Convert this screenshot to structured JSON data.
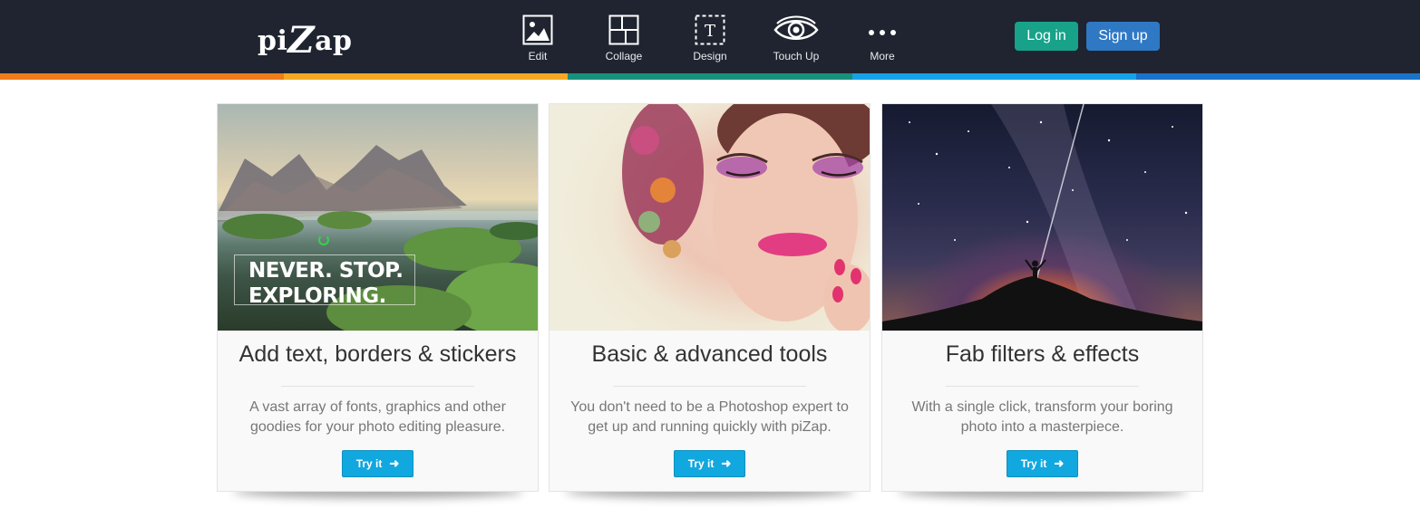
{
  "brand": {
    "logo_text_1": "pi",
    "logo_text_2": "Z",
    "logo_text_3": "ap"
  },
  "nav": [
    {
      "label": "Edit",
      "icon": "image-icon"
    },
    {
      "label": "Collage",
      "icon": "collage-grid-icon"
    },
    {
      "label": "Design",
      "icon": "text-frame-icon"
    },
    {
      "label": "Touch Up",
      "icon": "eye-icon"
    },
    {
      "label": "More",
      "icon": "ellipsis-icon"
    }
  ],
  "auth": {
    "login_label": "Log in",
    "signup_label": "Sign up"
  },
  "colors": {
    "header_bg": "#1f2430",
    "stripe": [
      "#f07d1a",
      "#f7a823",
      "#17917c",
      "#16a2e6",
      "#1a73c8"
    ],
    "login_bg": "#17a289",
    "signup_bg": "#2f78c4",
    "try_button_bg": "#10a8df"
  },
  "cards": [
    {
      "title": "Add text, borders & stickers",
      "description": "A vast array of fonts, graphics and other goodies for your photo editing pleasure.",
      "button_label": "Try it",
      "image_overlay_line1": "NEVER. STOP.",
      "image_overlay_line2": "EXPLORING."
    },
    {
      "title": "Basic & advanced tools",
      "description": "You don't need to be a Photoshop expert to get up and running quickly with piZap.",
      "button_label": "Try it"
    },
    {
      "title": "Fab filters & effects",
      "description": "With a single click, transform your boring photo into a masterpiece.",
      "button_label": "Try it"
    }
  ]
}
